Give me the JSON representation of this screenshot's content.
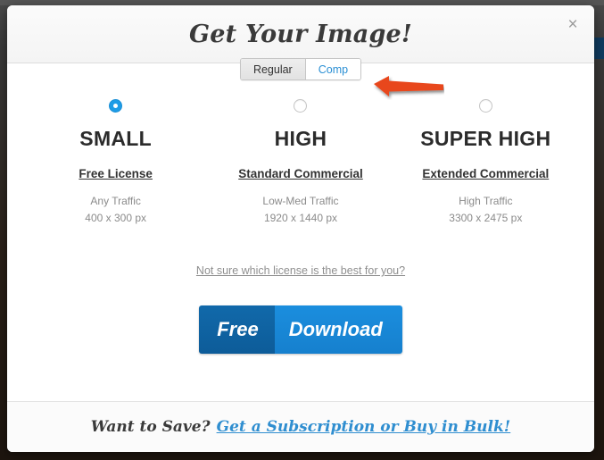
{
  "modal": {
    "title": "Get Your Image!",
    "close_label": "×",
    "close_icon": "close-icon"
  },
  "tabs": [
    {
      "label": "Regular",
      "active": true
    },
    {
      "label": "Comp",
      "active": false
    }
  ],
  "annotation": {
    "type": "red-arrow",
    "direction": "left",
    "color": "#e8471d",
    "points_at": "Comp tab"
  },
  "options": [
    {
      "size": "SMALL",
      "license": "Free License",
      "traffic": "Any Traffic",
      "dimensions": "400 x 300 px",
      "selected": true
    },
    {
      "size": "HIGH",
      "license": "Standard Commercial",
      "traffic": "Low-Med Traffic",
      "dimensions": "1920 x 1440 px",
      "selected": false
    },
    {
      "size": "SUPER HIGH",
      "license": "Extended Commercial",
      "traffic": "High Traffic",
      "dimensions": "3300 x 2475 px",
      "selected": false
    }
  ],
  "help_link": "Not sure which license is the best for you?",
  "download_button": {
    "left_label": "Free",
    "right_label": "Download",
    "left_color": "#0d5c99",
    "right_color": "#1b8ede"
  },
  "footer": {
    "text": "Want to Save?",
    "link": "Get a Subscription or Buy in Bulk!",
    "link_color": "#2f8ed0"
  }
}
